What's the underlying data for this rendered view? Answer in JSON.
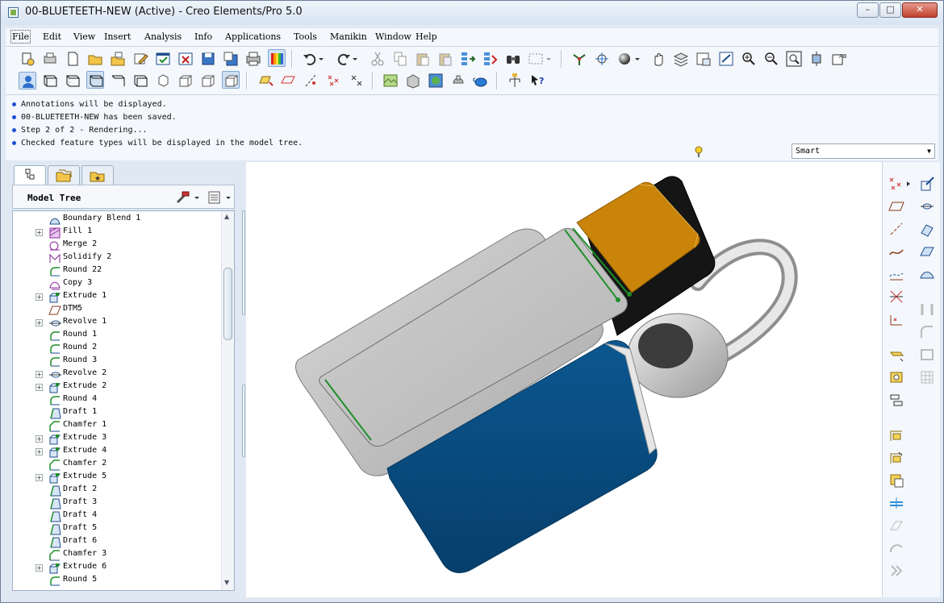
{
  "window": {
    "title": "00-BLUETEETH-NEW (Active) - Creo Elements/Pro 5.0",
    "controls": [
      "–",
      "□",
      "✕"
    ]
  },
  "menubar": {
    "items": [
      "File",
      "Edit",
      "View",
      "Insert",
      "Analysis",
      "Info",
      "Applications",
      "Tools",
      "Manikin",
      "Window",
      "Help"
    ]
  },
  "messages": [
    "Annotations will be displayed.",
    "00-BLUETEETH-NEW has been saved.",
    "Step 2 of 2 - Rendering...",
    "Checked feature types will be displayed in the model tree."
  ],
  "selection_filter": {
    "value": "Smart"
  },
  "model_tree": {
    "title": "Model Tree",
    "items": [
      {
        "label": "Boundary Blend 1",
        "icon": "boundary-blend",
        "expandable": false
      },
      {
        "label": "Fill 1",
        "icon": "fill",
        "expandable": true
      },
      {
        "label": "Merge 2",
        "icon": "merge",
        "expandable": false
      },
      {
        "label": "Solidify 2",
        "icon": "solidify",
        "expandable": false
      },
      {
        "label": "Round 22",
        "icon": "round",
        "expandable": false
      },
      {
        "label": "Copy 3",
        "icon": "copy",
        "expandable": false
      },
      {
        "label": "Extrude 1",
        "icon": "extrude",
        "expandable": true
      },
      {
        "label": "DTM5",
        "icon": "datum-plane",
        "expandable": false
      },
      {
        "label": "Revolve 1",
        "icon": "revolve",
        "expandable": true
      },
      {
        "label": "Round 1",
        "icon": "round",
        "expandable": false
      },
      {
        "label": "Round 2",
        "icon": "round",
        "expandable": false
      },
      {
        "label": "Round 3",
        "icon": "round",
        "expandable": false
      },
      {
        "label": "Revolve 2",
        "icon": "revolve",
        "expandable": true
      },
      {
        "label": "Extrude 2",
        "icon": "extrude",
        "expandable": true
      },
      {
        "label": "Round 4",
        "icon": "round",
        "expandable": false
      },
      {
        "label": "Draft 1",
        "icon": "draft",
        "expandable": false
      },
      {
        "label": "Chamfer 1",
        "icon": "chamfer",
        "expandable": false
      },
      {
        "label": "Extrude 3",
        "icon": "extrude",
        "expandable": true
      },
      {
        "label": "Extrude 4",
        "icon": "extrude",
        "expandable": true
      },
      {
        "label": "Chamfer 2",
        "icon": "chamfer",
        "expandable": false
      },
      {
        "label": "Extrude 5",
        "icon": "extrude",
        "expandable": true
      },
      {
        "label": "Draft 2",
        "icon": "draft",
        "expandable": false
      },
      {
        "label": "Draft 3",
        "icon": "draft",
        "expandable": false
      },
      {
        "label": "Draft 4",
        "icon": "draft",
        "expandable": false
      },
      {
        "label": "Draft 5",
        "icon": "draft",
        "expandable": false
      },
      {
        "label": "Draft 6",
        "icon": "draft",
        "expandable": false
      },
      {
        "label": "Chamfer 3",
        "icon": "chamfer",
        "expandable": false
      },
      {
        "label": "Extrude 6",
        "icon": "extrude",
        "expandable": true
      },
      {
        "label": "Round 5",
        "icon": "round",
        "expandable": false
      }
    ]
  },
  "colors": {
    "model_body": "#074a7d",
    "model_top_cap": "#c98409",
    "model_face_gray": "#c0c0c0",
    "model_edge_highlight": "#1f8f2a",
    "message_bullet": "#1d4fd1"
  }
}
